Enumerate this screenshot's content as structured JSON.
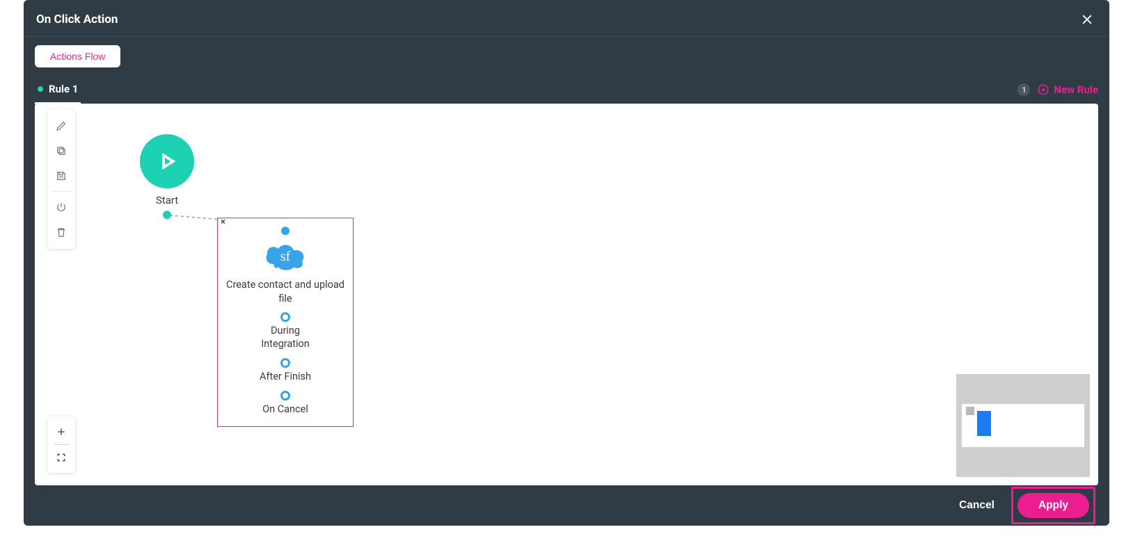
{
  "modal": {
    "title": "On Click Action",
    "actions_flow_label": "Actions Flow"
  },
  "tabs": {
    "rule_label": "Rule 1",
    "new_rule_label": "New Rule",
    "badge": "1"
  },
  "start_node": {
    "label": "Start"
  },
  "action_node": {
    "cloud_text": "sf",
    "title": "Create contact and upload file",
    "ports": {
      "during": "During Integration",
      "after": "After Finish",
      "cancel": "On Cancel"
    }
  },
  "footer": {
    "cancel": "Cancel",
    "apply": "Apply"
  }
}
